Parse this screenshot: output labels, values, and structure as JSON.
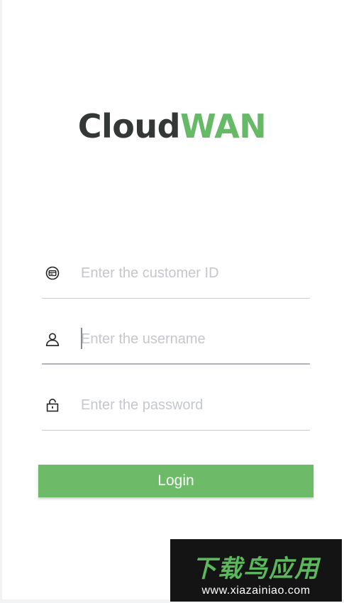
{
  "app": {
    "logo_part1": "Cloud",
    "logo_part2": "WAN",
    "brand_dark": "#333735",
    "brand_green": "#66b966"
  },
  "form": {
    "customer_id": {
      "icon": "card-icon",
      "value": "",
      "placeholder": "Enter the customer ID"
    },
    "username": {
      "icon": "user-icon",
      "value": "",
      "placeholder": "Enter the username",
      "focused": true
    },
    "password": {
      "icon": "lock-icon",
      "value": "",
      "placeholder": "Enter the password"
    },
    "login_label": "Login",
    "login_color": "#6dba68"
  },
  "watermark": {
    "title": "下载鸟应用",
    "url": "www.xiazainiao.com"
  }
}
